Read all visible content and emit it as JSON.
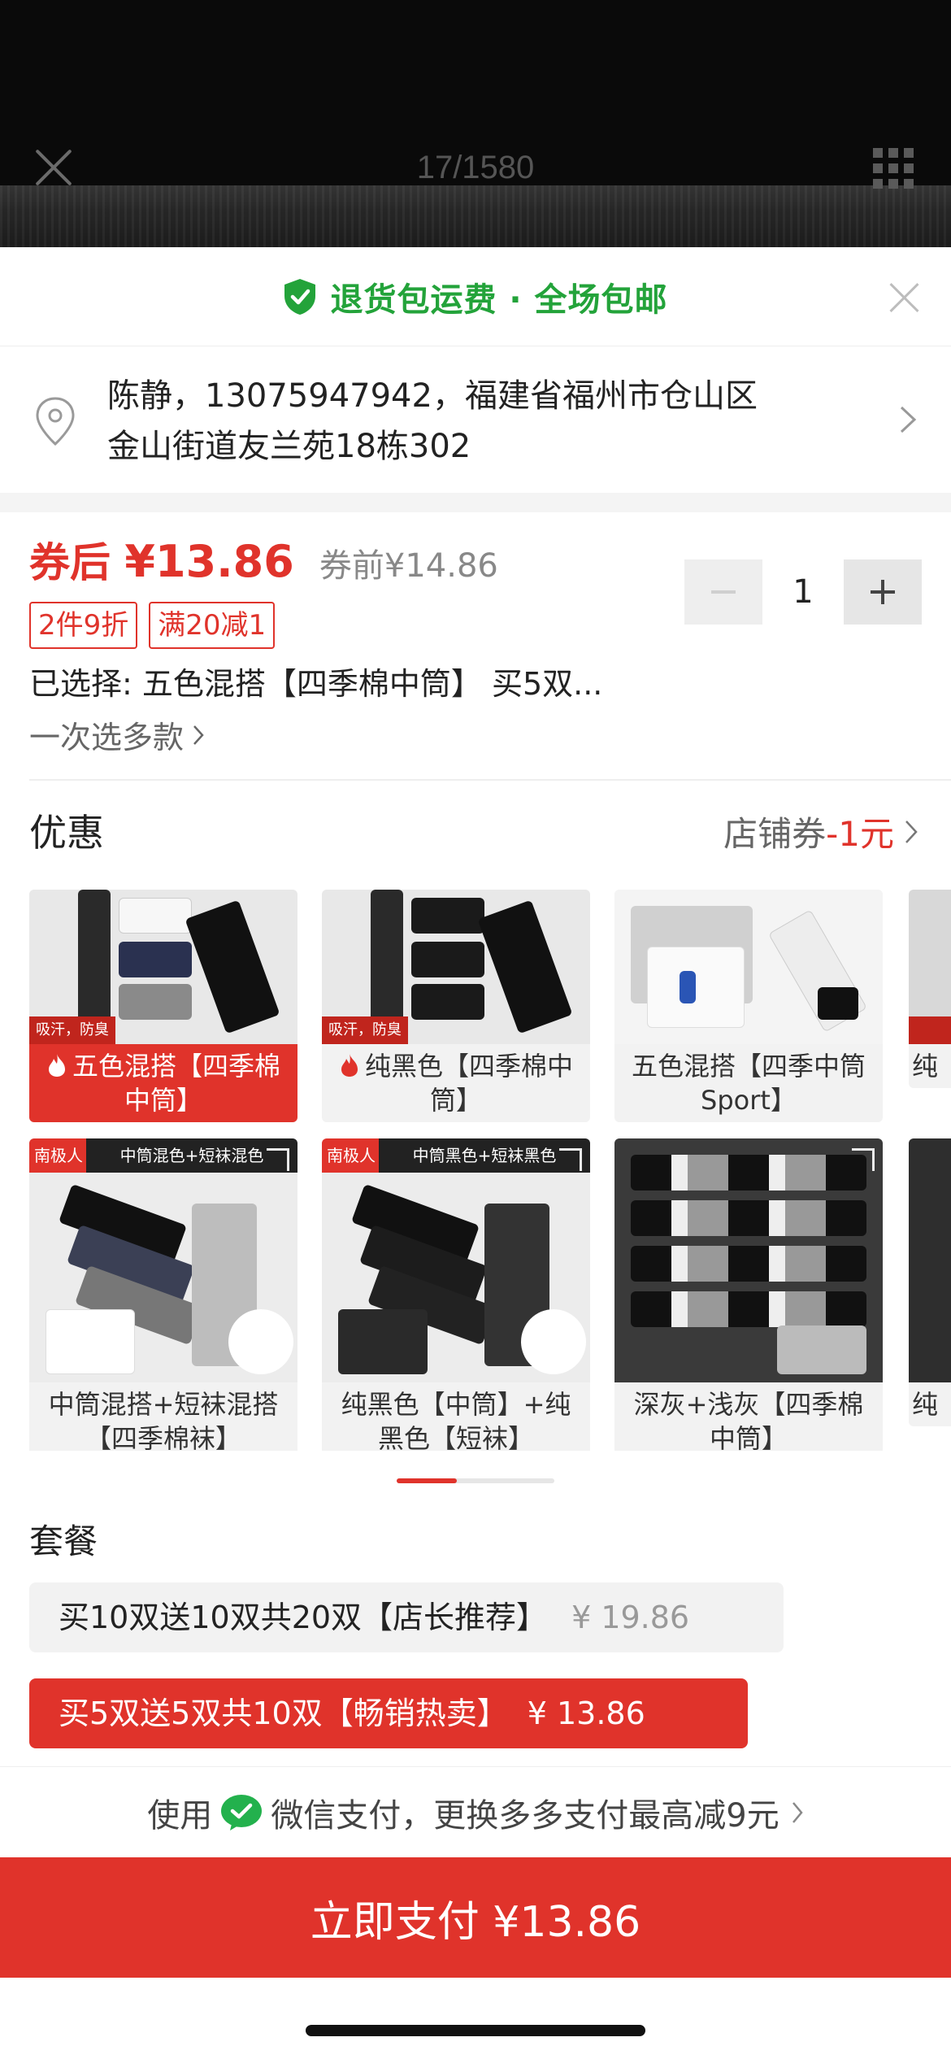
{
  "viewer": {
    "counter": "17/1580"
  },
  "banner": {
    "text": "退货包运费 · 全场包邮"
  },
  "address": {
    "line1": "陈静，13075947942，福建省福州市仓山区",
    "line2": "金山街道友兰苑18栋302"
  },
  "price": {
    "after_label": "券后",
    "after_value": "¥13.86",
    "before": "券前¥14.86",
    "tags": [
      "2件9折",
      "满20减1"
    ],
    "quantity": "1"
  },
  "selection": {
    "selected": "已选择: 五色混搭【四季棉中筒】 买5双...",
    "multi": "一次选多款"
  },
  "discount": {
    "title": "优惠",
    "coupon_prefix": "店铺券",
    "coupon_value": "-1元"
  },
  "products": [
    {
      "line1": "五色混搭【四季棉",
      "line2": "中筒】",
      "tag": "吸汗，防臭",
      "selected": true
    },
    {
      "line1": "纯黑色【四季棉中",
      "line2": "筒】",
      "tag": "吸汗，防臭",
      "selected": false
    },
    {
      "line1": "五色混搭【四季中筒",
      "line2": "Sport】",
      "tag": "",
      "selected": false
    },
    {
      "line1": "中筒混搭+短袜混搭",
      "line2": "【四季棉袜】",
      "tag": "中筒混色+短袜混色",
      "brand": "南极人",
      "selected": false
    },
    {
      "line1": "纯黑色【中筒】+纯",
      "line2": "黑色【短袜】",
      "tag": "中筒黑色+短袜黑色",
      "brand": "南极人",
      "selected": false
    },
    {
      "line1": "深灰+浅灰【四季棉",
      "line2": "中筒】",
      "tag": "",
      "selected": false
    },
    {
      "partial_top": "纯",
      "partial_bottom": "纯"
    }
  ],
  "packages": {
    "title": "套餐",
    "a": {
      "label": "买10双送10双共20双【店长推荐】",
      "price": "¥ 19.86"
    },
    "b": {
      "label": "买5双送5双共10双【畅销热卖】",
      "price": "¥ 13.86"
    }
  },
  "payment": {
    "use": "使用",
    "method_text": "微信支付，更换多多支付最高减9元",
    "button": "立即支付 ¥13.86"
  },
  "colors": {
    "accent": "#e0332b",
    "green": "#23a33a"
  }
}
